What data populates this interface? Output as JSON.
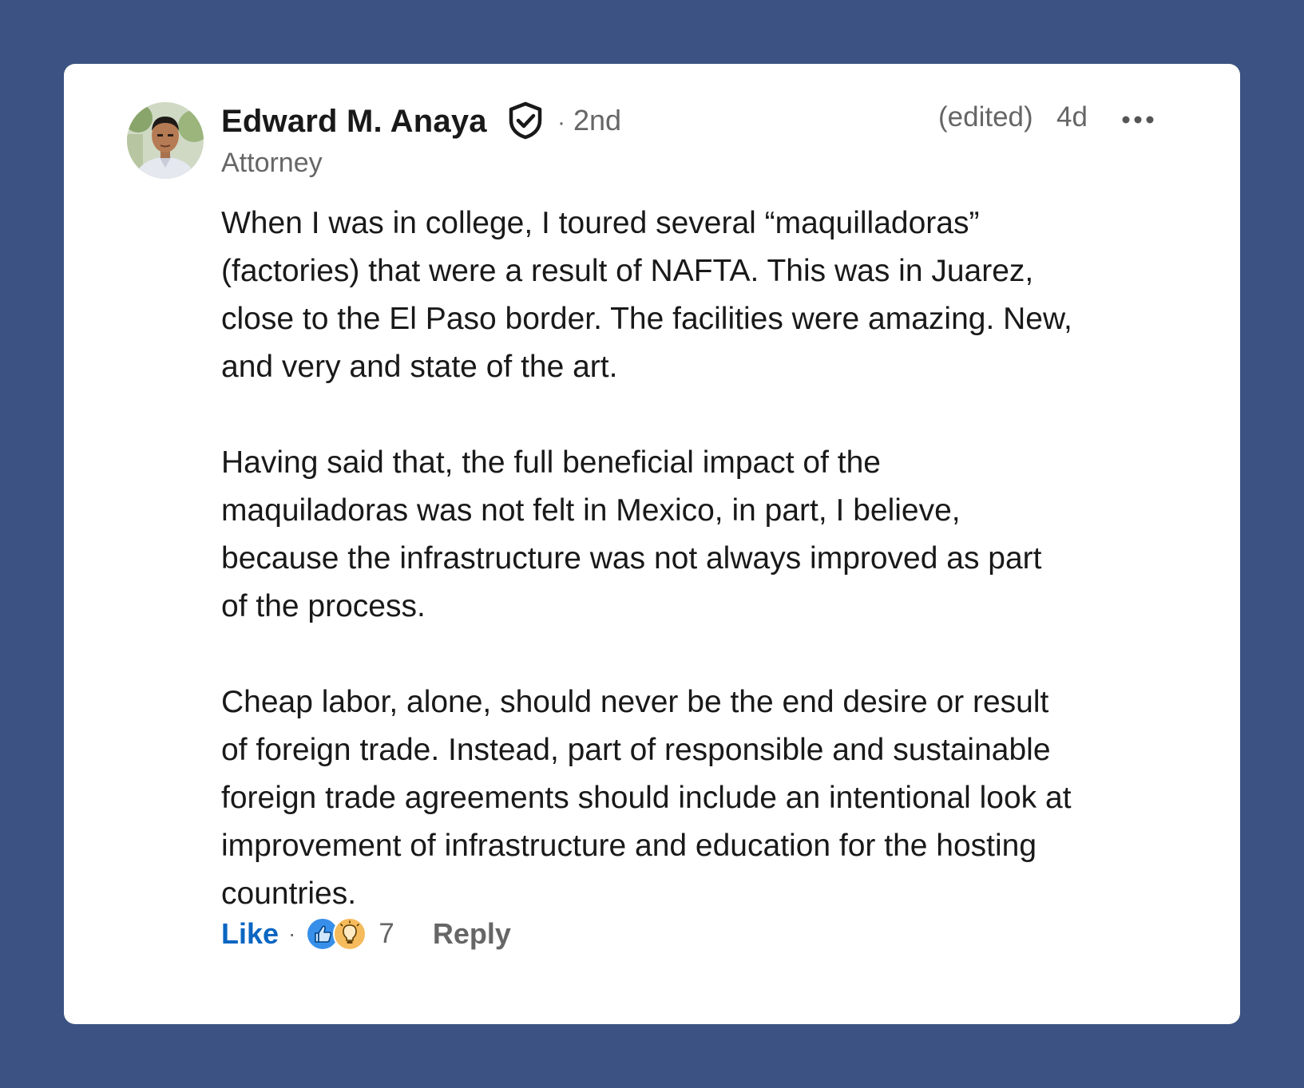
{
  "comment": {
    "author": {
      "name": "Edward M. Anaya",
      "degree": "2nd",
      "degree_separator": "·",
      "headline": "Attorney"
    },
    "edited_label": "(edited)",
    "timestamp": "4d",
    "more_icon": "more-horizontal-icon",
    "verified_icon": "verified-shield-icon",
    "paragraphs": [
      [
        "When I was in college, I toured several “maquilladoras”",
        "(factories) that were a result of NAFTA. This was in Juarez,",
        "close to the El Paso border. The facilities were amazing. New,",
        "and very and state of the art."
      ],
      [
        "Having said that, the full beneficial impact of the",
        "maquiladoras was not felt in Mexico, in part, I believe,",
        "because the infrastructure was not always improved as part",
        "of the process."
      ],
      [
        "Cheap labor, alone, should never be the end desire or result",
        "of foreign trade. Instead, part of responsible and sustainable",
        "foreign trade agreements should include an intentional look at",
        "improvement of infrastructure and education for the hosting",
        "countries."
      ]
    ],
    "actions": {
      "like_label": "Like",
      "separator": "·",
      "reaction_icons": [
        "like-reaction-icon",
        "insightful-reaction-icon"
      ],
      "reaction_count": "7",
      "reply_label": "Reply"
    }
  },
  "colors": {
    "background": "#3b5282",
    "card": "#ffffff",
    "text_primary": "#191919",
    "text_secondary": "#666666",
    "link_blue": "#0a66c2",
    "like_reaction": "#378fe9",
    "insightful_reaction": "#f5bb5c"
  }
}
